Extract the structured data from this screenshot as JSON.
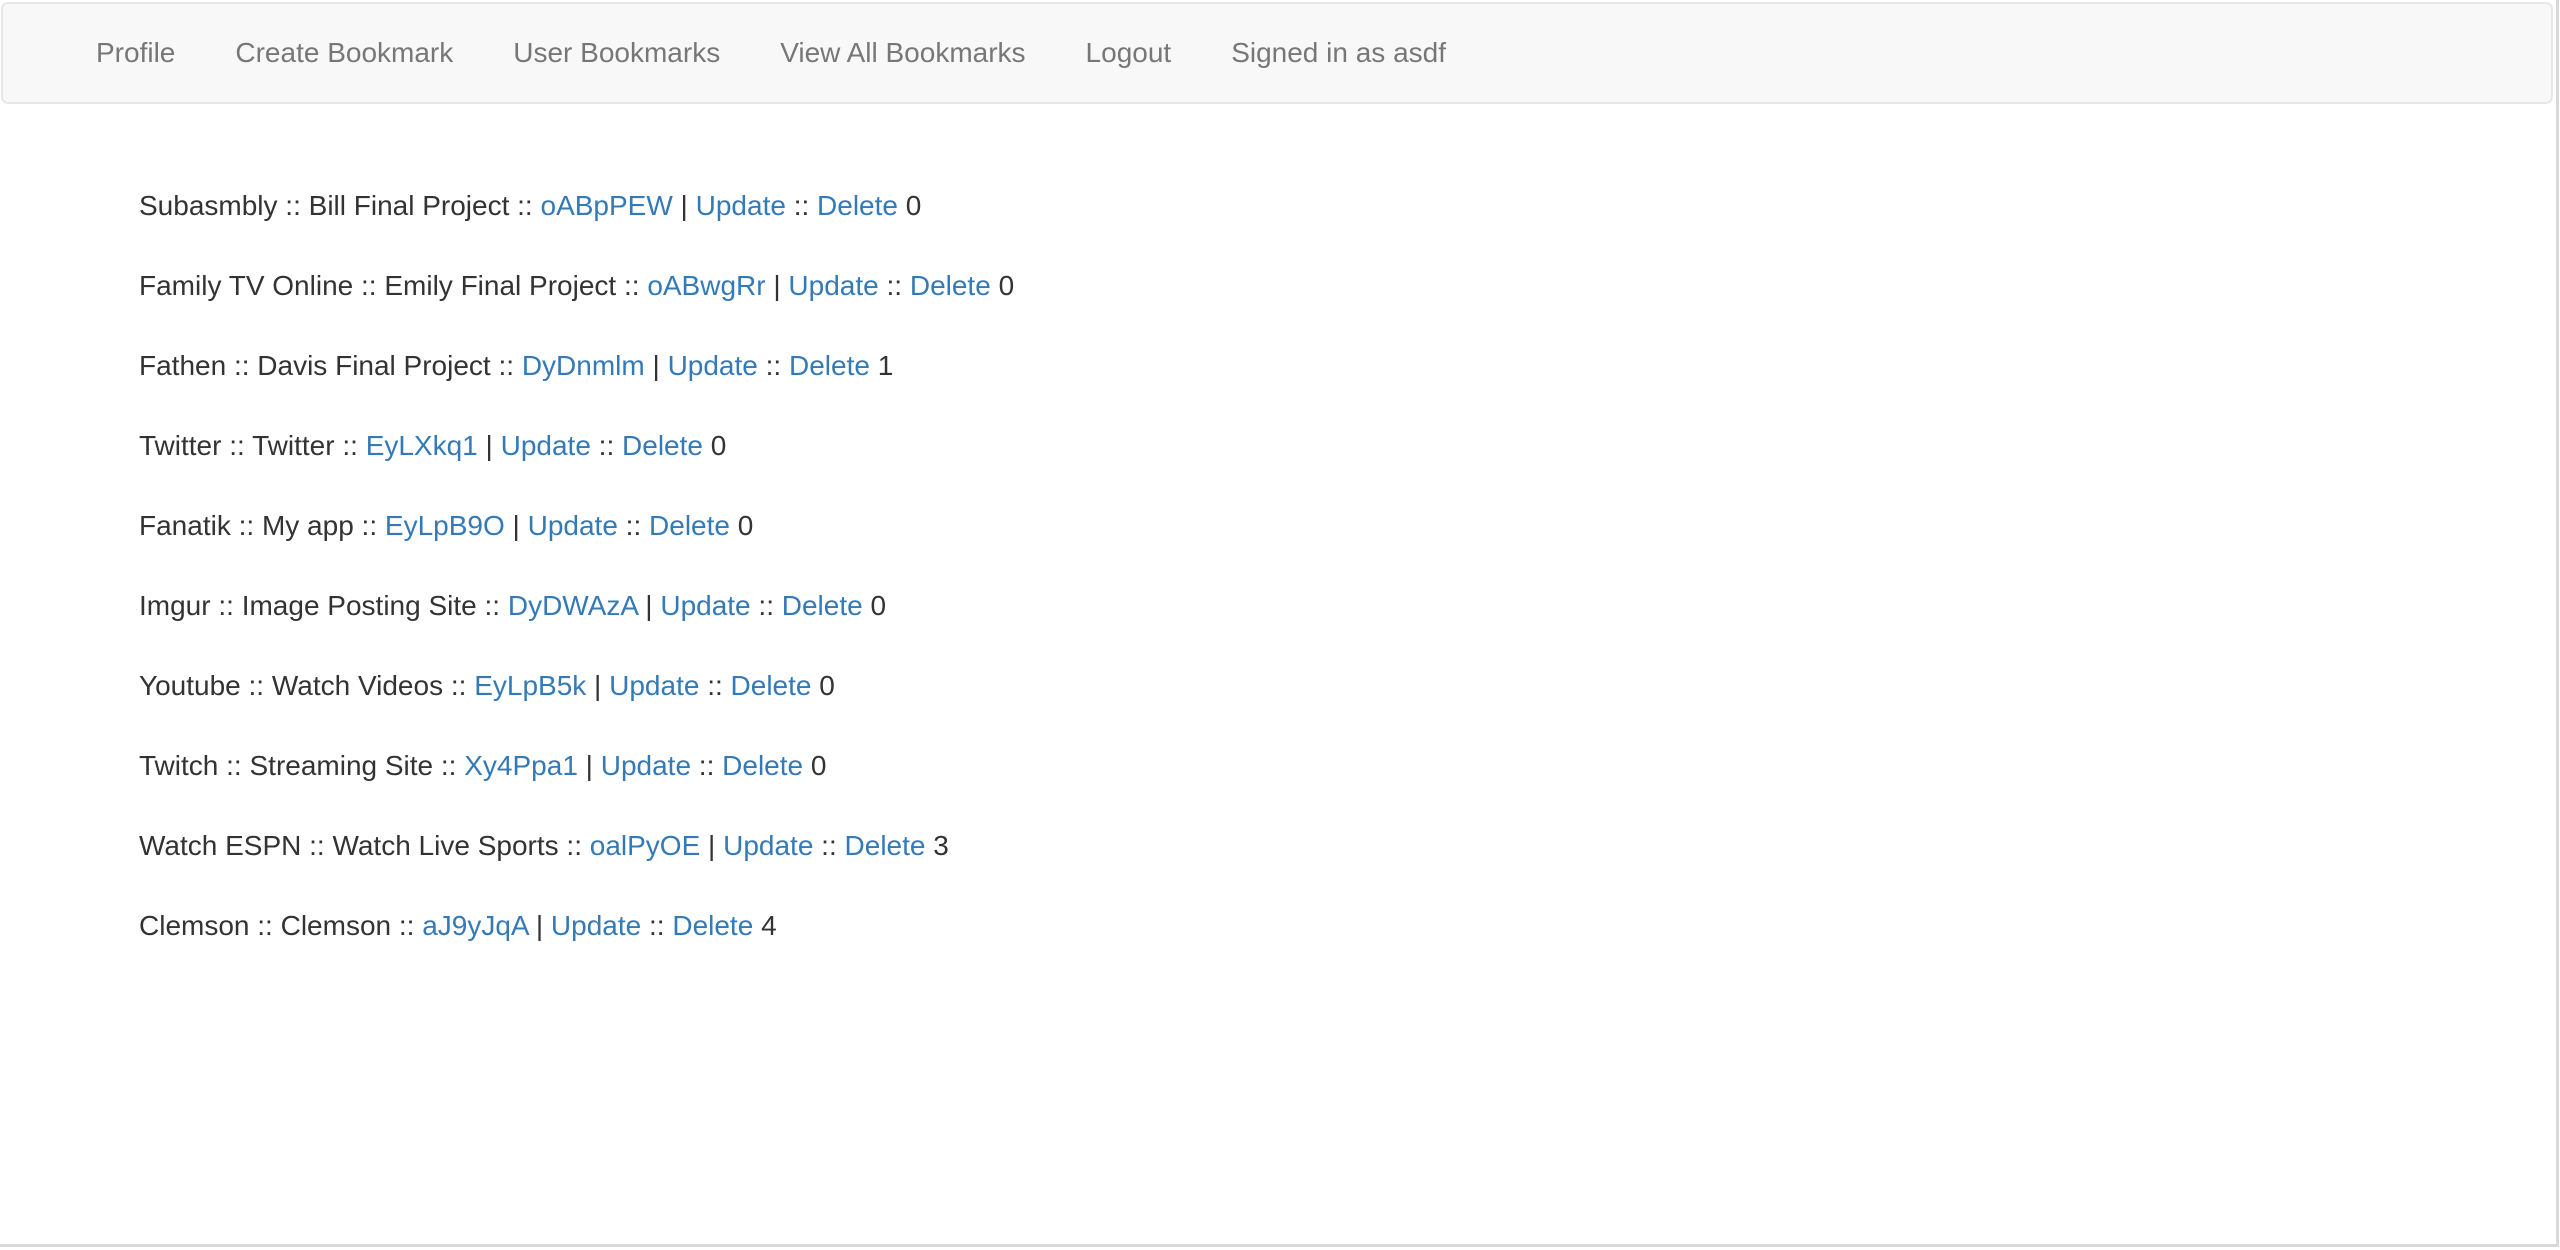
{
  "nav": {
    "items": [
      {
        "label": "Profile"
      },
      {
        "label": "Create Bookmark"
      },
      {
        "label": "User Bookmarks"
      },
      {
        "label": "View All Bookmarks"
      },
      {
        "label": "Logout"
      }
    ],
    "signed_in": "Signed in as asdf"
  },
  "separators": {
    "name_sep": " :: ",
    "pipe": " | ",
    "action_sep": " :: "
  },
  "bookmarks": [
    {
      "title": "Subasmbly",
      "description": "Bill Final Project",
      "code": "oABpPEW",
      "update": "Update",
      "delete": "Delete",
      "count": "0"
    },
    {
      "title": "Family TV Online",
      "description": "Emily Final Project",
      "code": "oABwgRr",
      "update": "Update",
      "delete": "Delete",
      "count": "0"
    },
    {
      "title": "Fathen",
      "description": "Davis Final Project",
      "code": "DyDnmlm",
      "update": "Update",
      "delete": "Delete",
      "count": "1"
    },
    {
      "title": "Twitter",
      "description": "Twitter",
      "code": "EyLXkq1",
      "update": "Update",
      "delete": "Delete",
      "count": "0"
    },
    {
      "title": "Fanatik",
      "description": "My app",
      "code": "EyLpB9O",
      "update": "Update",
      "delete": "Delete",
      "count": "0"
    },
    {
      "title": "Imgur",
      "description": "Image Posting Site",
      "code": "DyDWAzA",
      "update": "Update",
      "delete": "Delete",
      "count": "0"
    },
    {
      "title": "Youtube",
      "description": "Watch Videos",
      "code": "EyLpB5k",
      "update": "Update",
      "delete": "Delete",
      "count": "0"
    },
    {
      "title": "Twitch",
      "description": "Streaming Site",
      "code": "Xy4Ppa1",
      "update": "Update",
      "delete": "Delete",
      "count": "0"
    },
    {
      "title": "Watch ESPN",
      "description": "Watch Live Sports",
      "code": "oalPyOE",
      "update": "Update",
      "delete": "Delete",
      "count": "3"
    },
    {
      "title": "Clemson",
      "description": "Clemson",
      "code": "aJ9yJqA",
      "update": "Update",
      "delete": "Delete",
      "count": "4"
    }
  ],
  "colors": {
    "link": "#337ab7",
    "nav_text": "#777777",
    "nav_bg": "#f8f8f8",
    "text": "#333333"
  }
}
